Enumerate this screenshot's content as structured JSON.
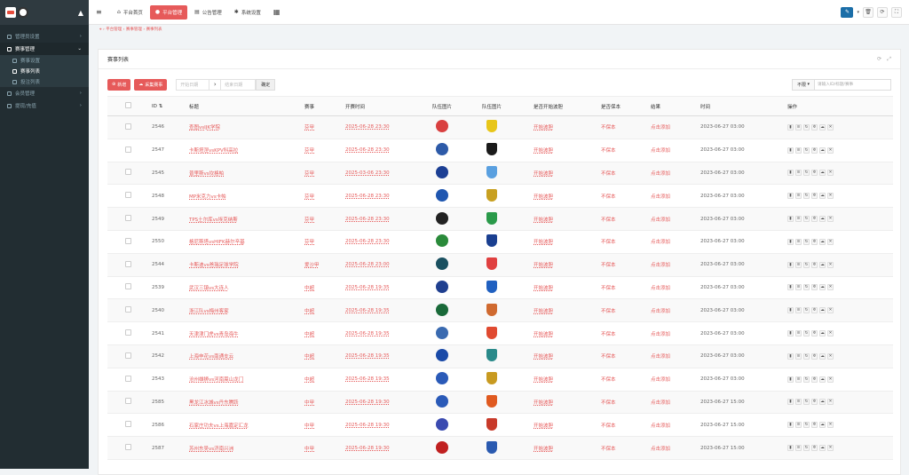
{
  "sidebar": {
    "items": [
      {
        "label": "管理员设置",
        "active": false,
        "sub": []
      },
      {
        "label": "赛事管理",
        "active": true,
        "sub": [
          "赛事设置",
          "赛事列表",
          "投注列表"
        ]
      },
      {
        "label": "会员管理",
        "active": false,
        "sub": []
      },
      {
        "label": "提现/充值",
        "active": false,
        "sub": []
      }
    ],
    "current_sub": 1
  },
  "topbar": {
    "tabs": [
      {
        "icon": "home-icon",
        "label": "平台首页",
        "active": false
      },
      {
        "icon": "user-icon",
        "label": "平台管理",
        "active": true
      },
      {
        "icon": "list-icon",
        "label": "公告管理",
        "active": false
      },
      {
        "icon": "gear-icon",
        "label": "系统设置",
        "active": false
      }
    ]
  },
  "breadcrumb": [
    "平台管理",
    "赛事管理",
    "赛事列表"
  ],
  "panel": {
    "title": "赛事列表"
  },
  "toolbar": {
    "add_label": "新增",
    "collect_label": "采集赛事",
    "start_date_placeholder": "开始日期",
    "end_date_placeholder": "结束日期",
    "confirm_label": "确定",
    "filter_select": "不限",
    "search_placeholder": "请输入ID/标题/赛事"
  },
  "table": {
    "headers": [
      "ID",
      "标题",
      "赛事",
      "开赛时间",
      "队伍图片",
      "队伍图片",
      "是否开始波胆",
      "是否保本",
      "结果",
      "时间",
      "操作"
    ],
    "rows": [
      {
        "id": "2546",
        "title": "查图vsIJK学院",
        "league": "芬甲",
        "start": "2025-06-28 23:30",
        "open": "开始波胆",
        "keep": "不保本",
        "result": "点击添加",
        "time": "2023-06-27 03:00",
        "c1": "#d94040",
        "c2": "#e8c619"
      },
      {
        "id": "2547",
        "title": "卡斯塔涅vsKPV科高拉",
        "league": "芬甲",
        "start": "2025-06-28 23:30",
        "open": "开始波胆",
        "keep": "不保本",
        "result": "点击添加",
        "time": "2023-06-27 03:00",
        "c1": "#2d5aa8",
        "c2": "#1a1a1a"
      },
      {
        "id": "2545",
        "title": "普里斯vs坎格帕",
        "league": "芬甲",
        "start": "2025-03-06 23:30",
        "open": "开始波胆",
        "keep": "不保本",
        "result": "点击添加",
        "time": "2023-06-27 03:00",
        "c1": "#1c3f94",
        "c2": "#5aa0e0"
      },
      {
        "id": "2548",
        "title": "MP米克力vs卡帕",
        "league": "芬甲",
        "start": "2025-06-28 23:30",
        "open": "开始波胆",
        "keep": "不保本",
        "result": "点击添加",
        "time": "2023-06-27 03:00",
        "c1": "#1f56b0",
        "c2": "#c8a020"
      },
      {
        "id": "2549",
        "title": "TPS土尔库vs埃克纳斯",
        "league": "芬甲",
        "start": "2025-06-28 23:30",
        "open": "开始波胆",
        "keep": "不保本",
        "result": "点击添加",
        "time": "2023-06-27 03:00",
        "c1": "#222222",
        "c2": "#2a9a4a"
      },
      {
        "id": "2550",
        "title": "格尼斯塔vsHIFK赫尔辛基",
        "league": "芬甲",
        "start": "2025-06-28 23:30",
        "open": "开始波胆",
        "keep": "不保本",
        "result": "点击添加",
        "time": "2023-06-27 03:00",
        "c1": "#2a8a3a",
        "c2": "#1a3f90"
      },
      {
        "id": "2544",
        "title": "卡斯迪vs爸瑞足球学院",
        "league": "爱沙甲",
        "start": "2025-06-28 23:00",
        "open": "开始波胆",
        "keep": "不保本",
        "result": "点击添加",
        "time": "2023-06-27 03:00",
        "c1": "#1a5060",
        "c2": "#e04040"
      },
      {
        "id": "2539",
        "title": "武汉三镇vs大连人",
        "league": "中超",
        "start": "2025-06-28 19:35",
        "open": "开始波胆",
        "keep": "不保本",
        "result": "点击添加",
        "time": "2023-06-27 03:00",
        "c1": "#1f3f8f",
        "c2": "#2060c0"
      },
      {
        "id": "2540",
        "title": "浙江队vs梅州客家",
        "league": "中超",
        "start": "2025-06-28 19:35",
        "open": "开始波胆",
        "keep": "不保本",
        "result": "点击添加",
        "time": "2023-06-27 03:00",
        "c1": "#1a6a3a",
        "c2": "#d06a30"
      },
      {
        "id": "2541",
        "title": "天津津门虎vs青岛海牛",
        "league": "中超",
        "start": "2025-06-28 19:35",
        "open": "开始波胆",
        "keep": "不保本",
        "result": "点击添加",
        "time": "2023-06-27 03:00",
        "c1": "#3a6ab0",
        "c2": "#e04a30"
      },
      {
        "id": "2542",
        "title": "上海申花vs南通支云",
        "league": "中超",
        "start": "2025-06-28 19:35",
        "open": "开始波胆",
        "keep": "不保本",
        "result": "点击添加",
        "time": "2023-06-27 03:00",
        "c1": "#1a4aa8",
        "c2": "#2a8a8a"
      },
      {
        "id": "2543",
        "title": "沧州雄狮vs河南嵩山龙门",
        "league": "中超",
        "start": "2025-06-28 19:35",
        "open": "开始波胆",
        "keep": "不保本",
        "result": "点击添加",
        "time": "2023-06-27 03:00",
        "c1": "#2a5ab8",
        "c2": "#c89a20"
      },
      {
        "id": "2585",
        "title": "黑龙江冰城vs丹东腾跃",
        "league": "中甲",
        "start": "2025-06-28 19:30",
        "open": "开始波胆",
        "keep": "不保本",
        "result": "点击添加",
        "time": "2023-06-27 15:00",
        "c1": "#2a5ab8",
        "c2": "#e05a20"
      },
      {
        "id": "2586",
        "title": "石家庄功夫vs上海嘉定汇龙",
        "league": "中甲",
        "start": "2025-06-28 19:30",
        "open": "开始波胆",
        "keep": "不保本",
        "result": "点击添加",
        "time": "2023-06-27 15:00",
        "c1": "#3a4ab0",
        "c2": "#c83a2a"
      },
      {
        "id": "2587",
        "title": "苏州东吴vs济南兴洲",
        "league": "中甲",
        "start": "2025-06-28 19:30",
        "open": "开始波胆",
        "keep": "不保本",
        "result": "点击添加",
        "time": "2023-06-27 15:00",
        "c1": "#c02020",
        "c2": "#2a5ab0"
      }
    ]
  }
}
